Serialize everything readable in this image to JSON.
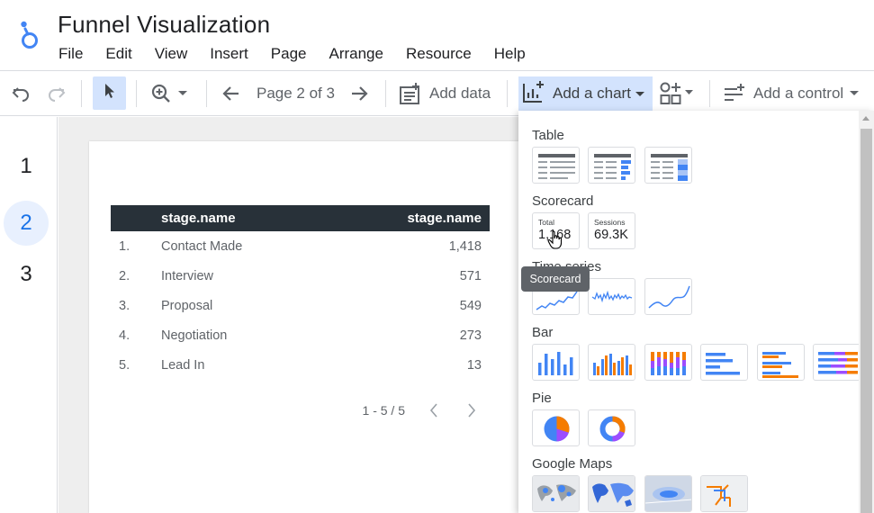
{
  "app": {
    "title": "Funnel Visualization",
    "menu": [
      "File",
      "Edit",
      "View",
      "Insert",
      "Page",
      "Arrange",
      "Resource",
      "Help"
    ]
  },
  "toolbar": {
    "page_indicator": "Page 2 of 3",
    "add_data_label": "Add data",
    "add_chart_label": "Add a chart",
    "add_control_label": "Add a control"
  },
  "pages": [
    "1",
    "2",
    "3"
  ],
  "active_page": "2",
  "table": {
    "headers": [
      "stage.name",
      "stage.name"
    ],
    "rows": [
      {
        "num": "1.",
        "name": "Contact Made",
        "value": "1,418"
      },
      {
        "num": "2.",
        "name": "Interview",
        "value": "571"
      },
      {
        "num": "3.",
        "name": "Proposal",
        "value": "549"
      },
      {
        "num": "4.",
        "name": "Negotiation",
        "value": "273"
      },
      {
        "num": "5.",
        "name": "Lead In",
        "value": "13"
      }
    ],
    "pagination": "1 - 5 / 5"
  },
  "chart_menu": {
    "sections": {
      "table": "Table",
      "scorecard": "Scorecard",
      "timeseries": "Time series",
      "bar": "Bar",
      "pie": "Pie",
      "maps": "Google Maps"
    },
    "scorecards": [
      {
        "label": "Total",
        "value": "1,168"
      },
      {
        "label": "Sessions",
        "value": "69.3K"
      }
    ],
    "tooltip": "Scorecard"
  },
  "colors": {
    "accent_blue": "#4285f4",
    "chart_orange": "#f57c00",
    "chart_purple": "#9c4dff",
    "selected_bg": "#d3e3fd",
    "table_header": "#283139"
  },
  "icons": [
    "undo-icon",
    "redo-icon",
    "cursor-icon",
    "zoom-icon",
    "arrow-left-icon",
    "arrow-right-icon",
    "add-data-icon",
    "add-chart-icon",
    "add-component-icon",
    "add-control-icon"
  ]
}
